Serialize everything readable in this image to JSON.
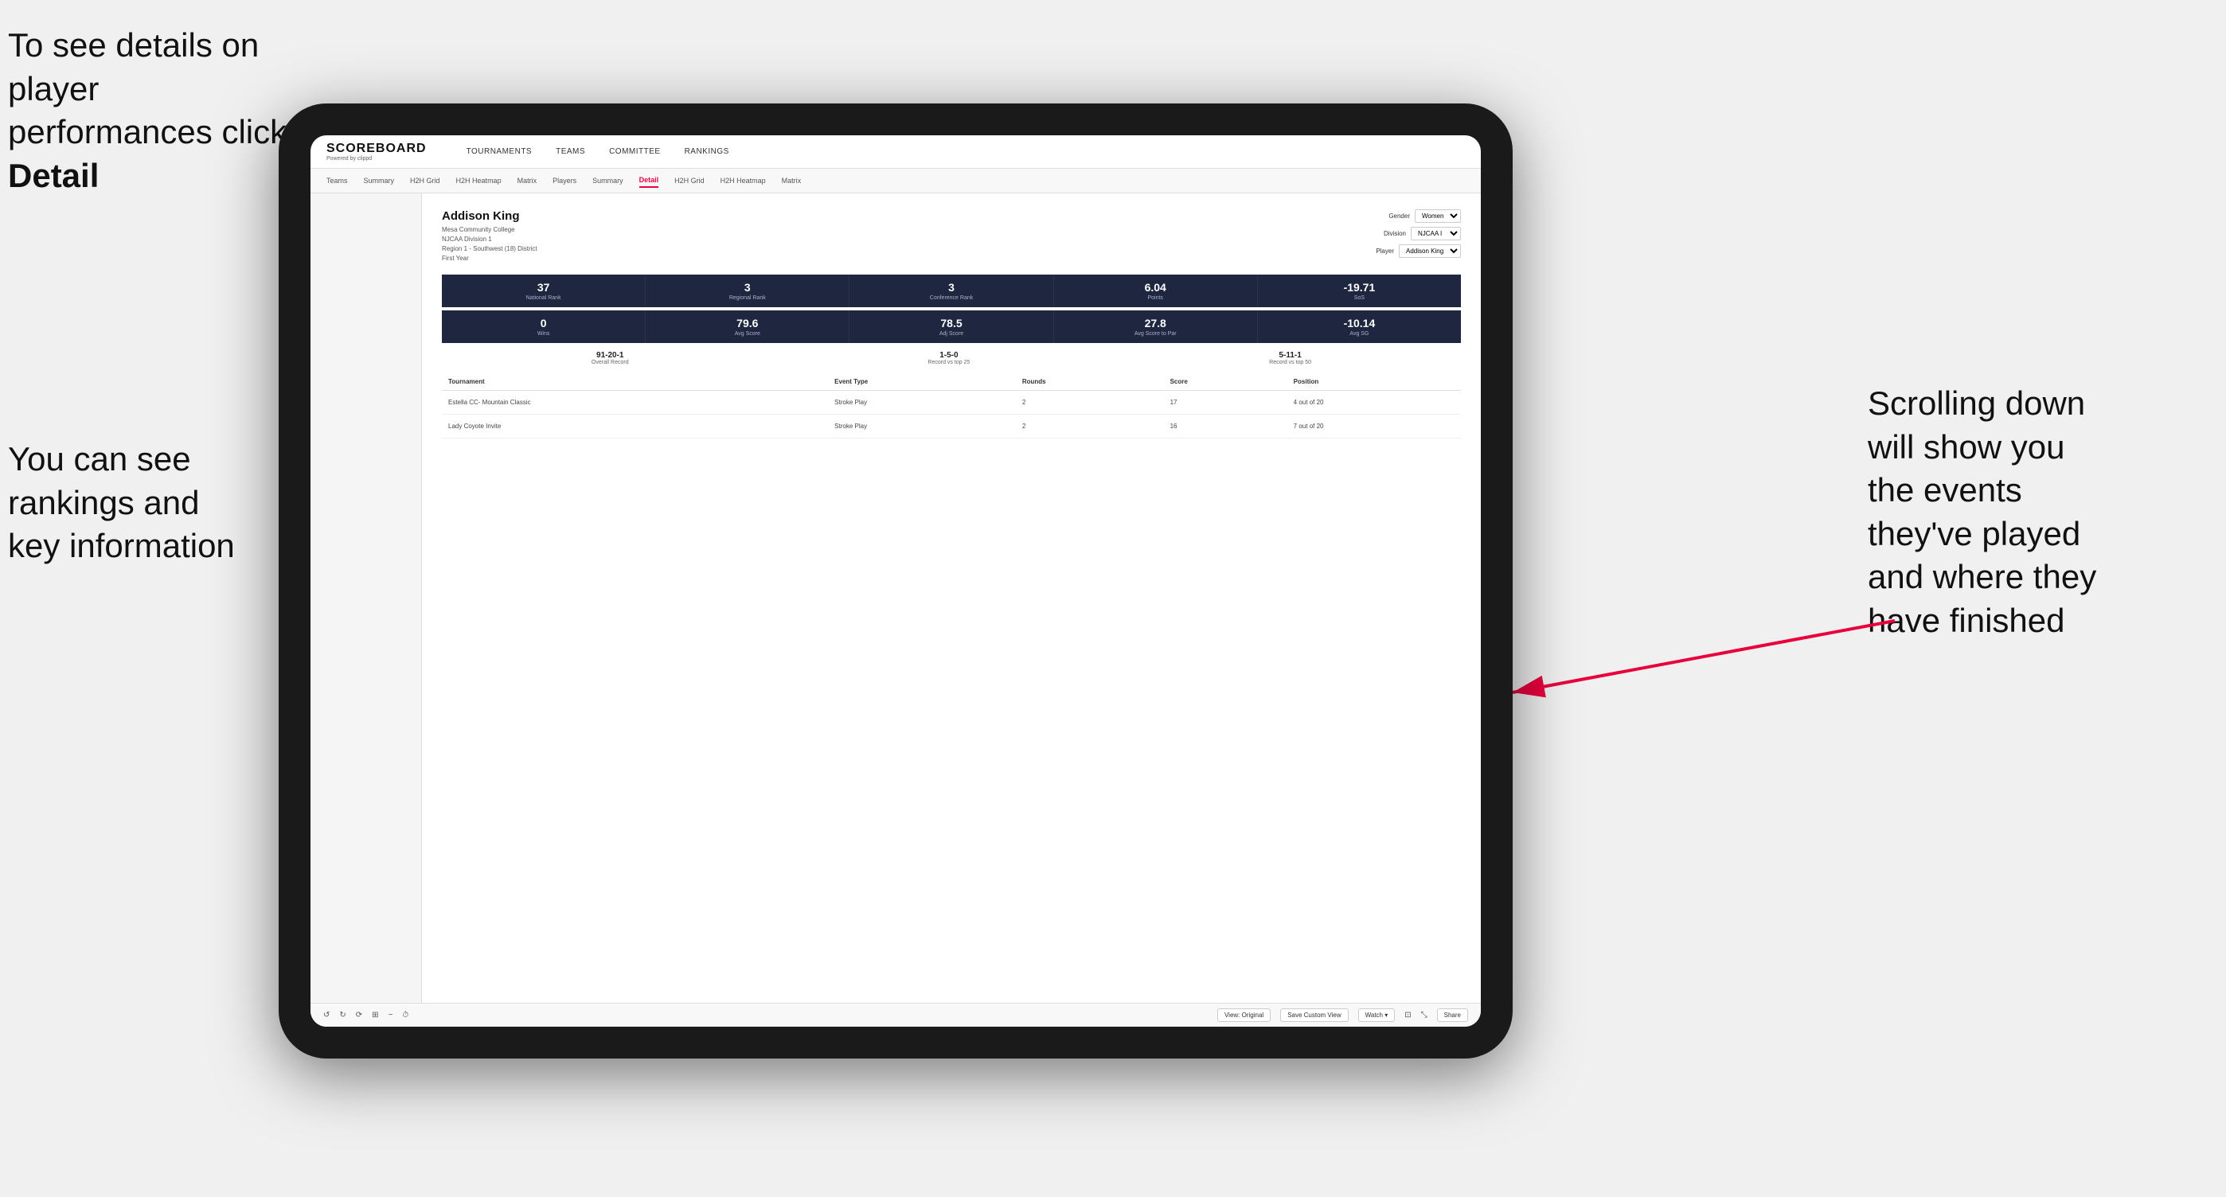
{
  "annotations": {
    "top_left": "To see details on player performances click ",
    "top_left_bold": "Detail",
    "bottom_left_line1": "You can see",
    "bottom_left_line2": "rankings and",
    "bottom_left_line3": "key information",
    "right_line1": "Scrolling down",
    "right_line2": "will show you",
    "right_line3": "the events",
    "right_line4": "they've played",
    "right_line5": "and where they",
    "right_line6": "have finished"
  },
  "nav": {
    "logo": "SCOREBOARD",
    "logo_sub": "Powered by clippd",
    "top_items": [
      "TOURNAMENTS",
      "TEAMS",
      "COMMITTEE",
      "RANKINGS"
    ],
    "sub_items": [
      "Teams",
      "Summary",
      "H2H Grid",
      "H2H Heatmap",
      "Matrix",
      "Players",
      "Summary",
      "Detail",
      "H2H Grid",
      "H2H Heatmap",
      "Matrix"
    ],
    "active_sub": "Detail"
  },
  "player": {
    "name": "Addison King",
    "school": "Mesa Community College",
    "division": "NJCAA Division 1",
    "region": "Region 1 - Southwest (18) District",
    "year": "First Year",
    "gender_label": "Gender",
    "gender_value": "Women",
    "division_label": "Division",
    "division_value": "NJCAA I",
    "player_label": "Player",
    "player_value": "Addison King"
  },
  "stats_row1": [
    {
      "value": "37",
      "label": "National Rank"
    },
    {
      "value": "3",
      "label": "Regional Rank"
    },
    {
      "value": "3",
      "label": "Conference Rank"
    },
    {
      "value": "6.04",
      "label": "Points"
    },
    {
      "value": "-19.71",
      "label": "SoS"
    }
  ],
  "stats_row2": [
    {
      "value": "0",
      "label": "Wins"
    },
    {
      "value": "79.6",
      "label": "Avg Score"
    },
    {
      "value": "78.5",
      "label": "Adj Score"
    },
    {
      "value": "27.8",
      "label": "Avg Score to Par"
    },
    {
      "value": "-10.14",
      "label": "Avg SG"
    }
  ],
  "records": [
    {
      "value": "91-20-1",
      "label": "Overall Record"
    },
    {
      "value": "1-5-0",
      "label": "Record vs top 25"
    },
    {
      "value": "5-11-1",
      "label": "Record vs top 50"
    }
  ],
  "table": {
    "headers": [
      "Tournament",
      "Event Type",
      "Rounds",
      "Score",
      "Position"
    ],
    "rows": [
      {
        "tournament": "Estella CC- Mountain Classic",
        "event_type": "Stroke Play",
        "rounds": "2",
        "score": "17",
        "position": "4 out of 20"
      },
      {
        "tournament": "Lady Coyote Invite",
        "event_type": "Stroke Play",
        "rounds": "2",
        "score": "16",
        "position": "7 out of 20"
      }
    ]
  },
  "toolbar": {
    "buttons": [
      "View: Original",
      "Save Custom View",
      "Watch ▾",
      "Share"
    ]
  }
}
